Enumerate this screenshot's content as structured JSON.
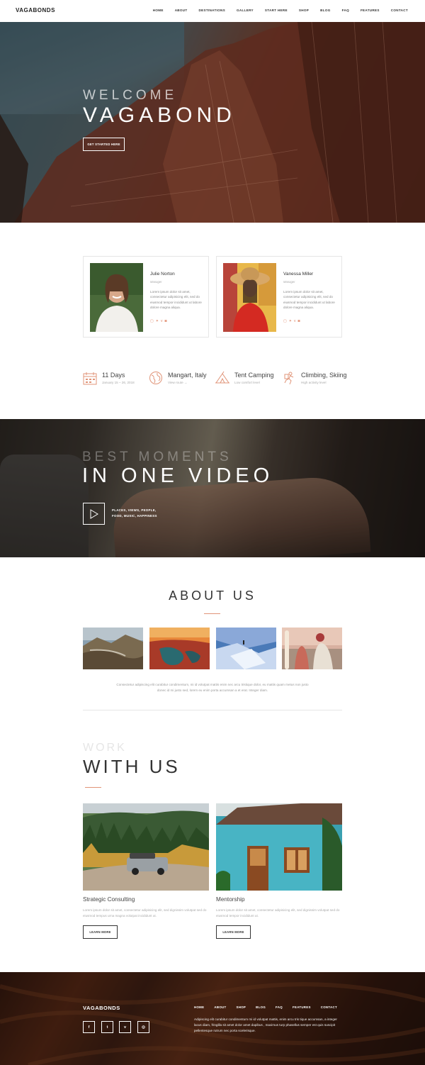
{
  "header": {
    "logo": "VAGABONDS",
    "nav": [
      "HOME",
      "ABOUT",
      "DESTINATIONS",
      "GALLERY",
      "START HERE",
      "SHOP",
      "BLOG",
      "FAQ",
      "FEATURES",
      "CONTACT"
    ]
  },
  "hero": {
    "welcome": "WELCOME",
    "title": "VAGABOND",
    "button": "GET STARTED HERE"
  },
  "team": [
    {
      "name": "Julie Norton",
      "role": "Manager",
      "bio": "Lorem ipsum dolor sit amet, consectetur adipisicing elit, sed do eiusmod tempor incididunt ut labore dolore magna aliqua.",
      "socials": [
        "facebook-icon",
        "twitter-icon",
        "vimeo-icon",
        "instagram-icon"
      ]
    },
    {
      "name": "Vanessa Miller",
      "role": "Manager",
      "bio": "Lorem ipsum dolor sit amet, consectetur adipisicing elit, sed do eiusmod tempor incididunt ut labore dolore magna aliqua.",
      "socials": [
        "facebook-icon",
        "twitter-icon",
        "vimeo-icon",
        "instagram-icon"
      ]
    }
  ],
  "features": [
    {
      "icon": "calendar-icon",
      "title": "11 Days",
      "sub": "January 15 – 26, 2018"
    },
    {
      "icon": "globe-icon",
      "title": "Mangart, Italy",
      "sub": "View route  →"
    },
    {
      "icon": "tent-icon",
      "title": "Tent Camping",
      "sub": "Low comfort level"
    },
    {
      "icon": "climber-icon",
      "title": "Climbing, Skiing",
      "sub": "High activity level"
    }
  ],
  "video": {
    "small": "BEST MOMENTS",
    "big": "IN ONE VIDEO",
    "caption_line1": "PLACES, VIEWS, PEOPLE,",
    "caption_line2": "FOOD, MUSIC, HAPPINESS"
  },
  "about": {
    "title": "ABOUT US",
    "text": "Consectetur adipiscing elit curabitur condimentum, mi id volutpat mattis enim nec arcu tristique dolor, eu mattis quam metus non justo donec id mi justo sed, lorem eu enim porta accumsan a et erat. Integer diam."
  },
  "work": {
    "small": "WORK",
    "big": "WITH US",
    "items": [
      {
        "title": "Strategic Consulting",
        "text": "Lorem ipsum dolor sit amet, consectetur adipisicing elit, sed dignissim volutpat sed do eiusmod tempus urna magna volutpat incididunt ut.",
        "button": "LEARN MORE"
      },
      {
        "title": "Mentorship",
        "text": "Lorem ipsum dolor sit amet, consectetur adipisicing elit, sed dignissim volutpat sed do eiusmod tempor incididunt ut.",
        "button": "LEARN MORE"
      }
    ]
  },
  "footer": {
    "logo": "VAGABONDS",
    "nav": [
      "HOME",
      "ABOUT",
      "SHOP",
      "BLOG",
      "FAQ",
      "FEATURES",
      "CONTACT"
    ],
    "text": "Adipiscing elit curabitur condimentum mi id volutpat mattis, enim arcu tris tique accumsan, a integer lacus diam, fringilla sit amet dolor amet dapibus , maximus turp phasellus semper est quis suscipit pellentesque rutrum nec porta scelerisque.",
    "socials": [
      "facebook-icon",
      "twitter-icon",
      "vimeo-icon",
      "instagram-icon"
    ]
  },
  "colors": {
    "accent": "#e09478",
    "text": "#333333",
    "muted": "#aaaaaa"
  }
}
